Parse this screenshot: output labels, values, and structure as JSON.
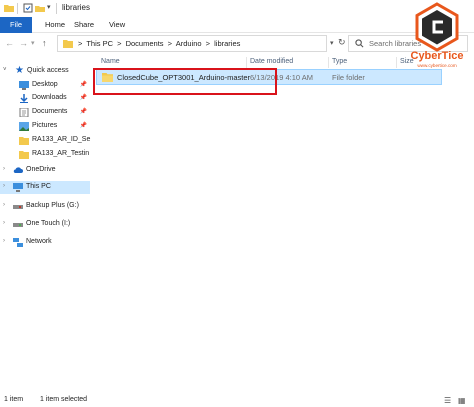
{
  "window": {
    "title": "libraries"
  },
  "ribbon": {
    "tabs": [
      "File",
      "Home",
      "Share",
      "View"
    ]
  },
  "address": {
    "crumbs": [
      "This PC",
      "Documents",
      "Arduino",
      "libraries"
    ],
    "separator": ">"
  },
  "search": {
    "placeholder": "Search libraries"
  },
  "sidebar": {
    "quick_access": "Quick access",
    "items": [
      {
        "label": "Desktop",
        "pinned": true,
        "icon": "desktop-icon"
      },
      {
        "label": "Downloads",
        "pinned": true,
        "icon": "download-icon"
      },
      {
        "label": "Documents",
        "pinned": true,
        "icon": "document-icon"
      },
      {
        "label": "Pictures",
        "pinned": true,
        "icon": "picture-icon"
      },
      {
        "label": "RA133_AR_ID_Se",
        "pinned": false,
        "icon": "folder-icon"
      },
      {
        "label": "RA133_AR_Testin",
        "pinned": false,
        "icon": "folder-icon"
      }
    ],
    "onedrive": "OneDrive",
    "this_pc": "This PC",
    "drives": [
      "Backup Plus (G:)",
      "One Touch (I:)"
    ],
    "network": "Network"
  },
  "columns": {
    "name": "Name",
    "date": "Date modified",
    "type": "Type",
    "size": "Size"
  },
  "files": [
    {
      "name": "ClosedCube_OPT3001_Arduino-master",
      "date": "6/13/2019 4:10 AM",
      "type": "File folder"
    }
  ],
  "status": {
    "item_count": "1 item",
    "selected": "1 item selected"
  },
  "watermark": {
    "brand": "CyberTice",
    "url": "www.cybertice.com"
  },
  "colors": {
    "accent": "#1c66c4",
    "selection": "#cce8ff",
    "folder": "#f3c94d",
    "highlight": "#d9131b",
    "brand": "#e8571c"
  }
}
